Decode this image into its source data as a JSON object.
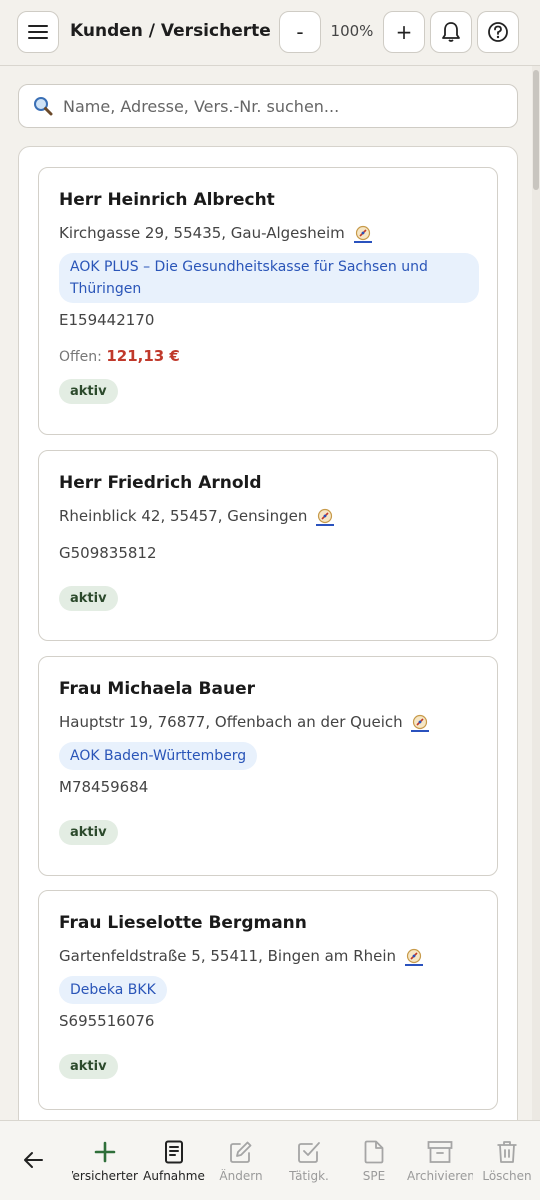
{
  "header": {
    "title": "Kunden / Versicherte",
    "zoom_minus": "-",
    "zoom_level": "100%",
    "zoom_plus": "+"
  },
  "search": {
    "placeholder": "Name, Adresse, Vers.-Nr. suchen..."
  },
  "customers": [
    {
      "name": "Herr Heinrich Albrecht",
      "address": "Kirchgasse 29, 55435, Gau-Algesheim",
      "insurance": "AOK PLUS – Die Gesundheitskasse für Sachsen und Thüringen",
      "vnr": "E159442170",
      "open_label": "Offen:",
      "open_amount": "121,13 €",
      "status": "aktiv"
    },
    {
      "name": "Herr Friedrich Arnold",
      "address": "Rheinblick 42, 55457, Gensingen",
      "vnr": "G509835812",
      "status": "aktiv"
    },
    {
      "name": "Frau Michaela Bauer",
      "address": "Hauptstr 19, 76877, Offenbach an der Queich",
      "insurance": "AOK Baden-Württemberg",
      "vnr": "M78459684",
      "status": "aktiv"
    },
    {
      "name": "Frau Lieselotte Bergmann",
      "address": "Gartenfeldstraße 5, 55411, Bingen am Rhein",
      "insurance": "Debeka BKK",
      "vnr": "S695516076",
      "status": "aktiv"
    }
  ],
  "bottombar": {
    "new_label": "Neuer Versicherter",
    "aufnahme_label": "Aufnahme",
    "aendern_label": "Ändern",
    "taetigk_label": "Tätigk.",
    "spe_label": "SPE",
    "archivieren_label": "Archivieren",
    "loeschen_label": "Löschen"
  },
  "colors": {
    "accent_green": "#2f6f3a",
    "open_amount_red": "#c0392b",
    "insurance_badge_bg": "#e8f1fc",
    "insurance_badge_text": "#2a55b8",
    "status_badge_bg": "#e3ede3"
  }
}
